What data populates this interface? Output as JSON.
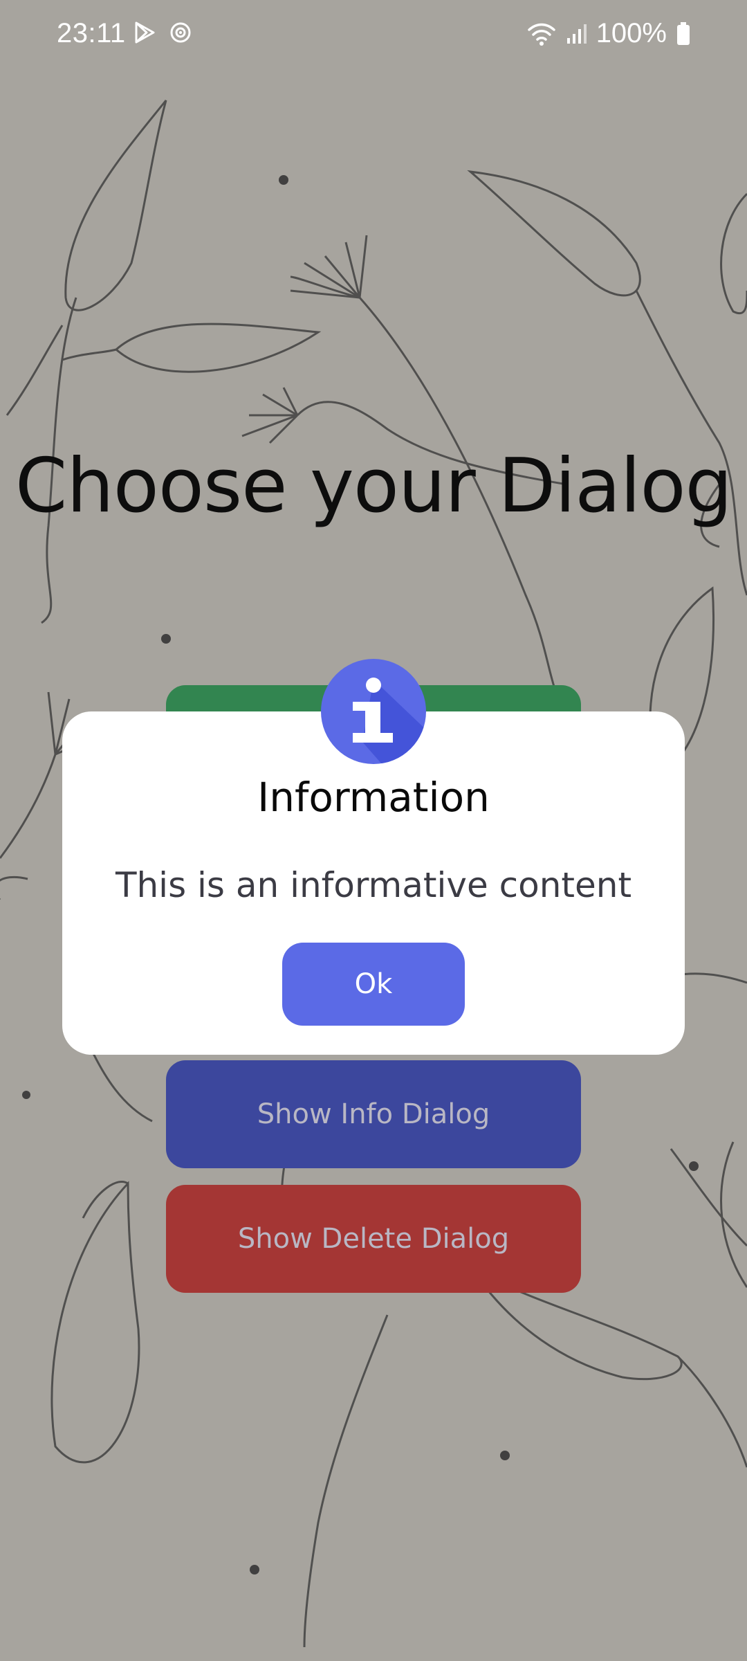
{
  "status_bar": {
    "time": "23:11",
    "battery": "100%",
    "icons": [
      "play-store-icon",
      "sync-icon",
      "wifi-icon",
      "signal-icon",
      "battery-icon"
    ]
  },
  "main": {
    "title": "Choose your Dialog",
    "buttons": {
      "green": "",
      "info": "Show Info Dialog",
      "delete": "Show Delete Dialog"
    }
  },
  "dialog": {
    "title": "Information",
    "message": "This is an informative content",
    "ok_label": "Ok",
    "icon": "info-icon"
  },
  "colors": {
    "background": "#a7a49e",
    "green_button": "#328550",
    "blue_button": "#3c479d",
    "red_button": "#a43634",
    "dialog_accent": "#5b6ae6"
  }
}
